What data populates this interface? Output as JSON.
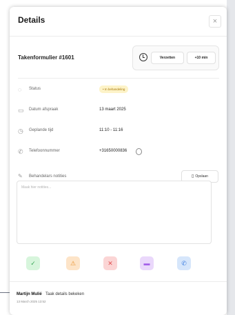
{
  "panel": {
    "title": "Details",
    "close_label": "×"
  },
  "task": {
    "name": "Takenformulier #1601",
    "clock_icon": "clock-icon",
    "buttons": {
      "move_label": "Verzetten",
      "add_label": "+10 min"
    }
  },
  "fields": {
    "status": {
      "icon": "circle-icon",
      "label": "Status",
      "value": "• In behandeling",
      "badge_color": "#fdf3c8",
      "badge_text_color": "#a8780a"
    },
    "date": {
      "icon": "calendar-icon",
      "label": "Datum afspraak",
      "value": "13 maart 2025"
    },
    "time": {
      "icon": "clock-icon",
      "label": "Geplande tijd",
      "value": "11:10 - 11:16"
    },
    "phone": {
      "icon": "phone-icon",
      "label": "Telefoonnummer",
      "value": "+31650000836"
    }
  },
  "notes": {
    "icon": "pen-icon",
    "label": "Behandelars notities",
    "save_label": "Opslaan",
    "placeholder": "Maak hier notities...",
    "value": ""
  },
  "actions": [
    {
      "name": "check",
      "color": "#3aa757",
      "bg": "#d7f5dc"
    },
    {
      "name": "warning",
      "color": "#e8912b",
      "bg": "#fde4c8"
    },
    {
      "name": "close",
      "color": "#e05252",
      "bg": "#fbd5d5"
    },
    {
      "name": "message",
      "color": "#a560e8",
      "bg": "#ead8fb"
    },
    {
      "name": "phone",
      "color": "#3f7fe0",
      "bg": "#d6e6fb"
    }
  ],
  "log": {
    "user": "Martijn Mulié",
    "action": "Taak details bekeken",
    "time": "13 March 2025 13:52"
  }
}
